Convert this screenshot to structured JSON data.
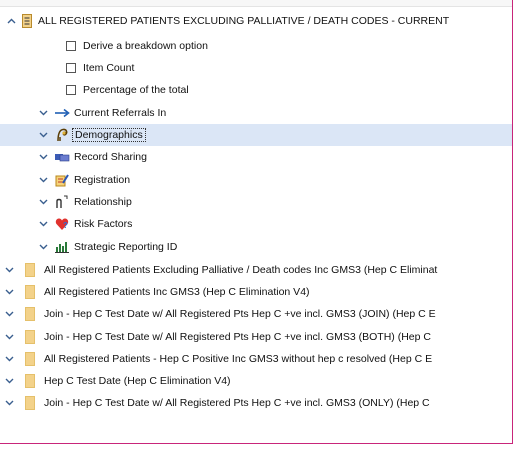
{
  "tree": {
    "root": {
      "label": "ALL REGISTERED PATIENTS EXCLUDING PALLIATIVE / DEATH CODES - CURRENT",
      "icon": "report-icon"
    },
    "options": [
      {
        "label": "Derive a breakdown option",
        "checked": false
      },
      {
        "label": "Item Count",
        "checked": false
      },
      {
        "label": "Percentage of the total",
        "checked": false
      }
    ],
    "categories": [
      {
        "label": "Current Referrals In",
        "icon": "arrow-right-icon"
      },
      {
        "label": "Demographics",
        "icon": "demographics-icon",
        "selected": true
      },
      {
        "label": "Record Sharing",
        "icon": "record-sharing-icon"
      },
      {
        "label": "Registration",
        "icon": "registration-icon"
      },
      {
        "label": "Relationship",
        "icon": "relationship-icon"
      },
      {
        "label": "Risk Factors",
        "icon": "risk-factors-icon"
      },
      {
        "label": "Strategic Reporting ID",
        "icon": "strategic-reporting-icon"
      }
    ],
    "reports": [
      {
        "label": "All Registered Patients Excluding Palliative / Death codes Inc GMS3 (Hep C Eliminat"
      },
      {
        "label": "All Registered Patients Inc GMS3 (Hep C Elimination V4)"
      },
      {
        "label": "Join - Hep C Test Date w/ All Registered Pts Hep C +ve incl. GMS3 (JOIN) (Hep C E"
      },
      {
        "label": "Join - Hep C Test Date w/ All Registered Pts Hep C +ve incl. GMS3 (BOTH) (Hep C"
      },
      {
        "label": "All Registered Patients - Hep C Positive Inc GMS3 without hep c resolved (Hep C E"
      },
      {
        "label": "Hep C Test Date (Hep C Elimination V4)"
      },
      {
        "label": "Join - Hep C Test Date w/ All Registered Pts Hep C +ve incl. GMS3 (ONLY) (Hep C"
      }
    ]
  },
  "colors": {
    "accent": "#c8257a",
    "selection": "#dbe6f6",
    "chevron": "#3a5f8f"
  }
}
